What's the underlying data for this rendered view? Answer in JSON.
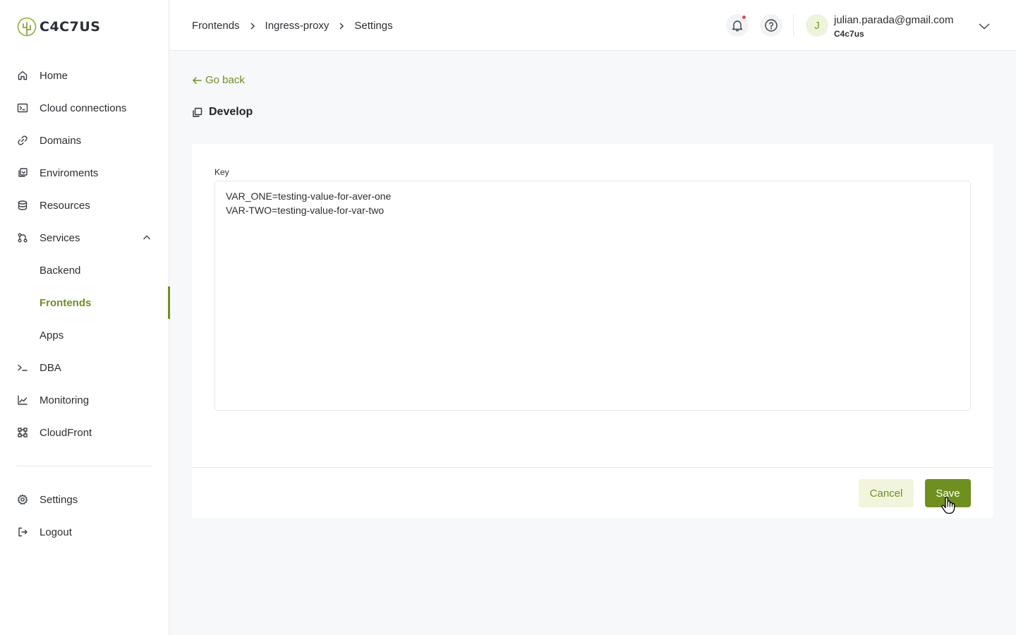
{
  "app": {
    "logo_text": "C4C7US"
  },
  "sidebar": {
    "items": [
      {
        "label": "Home",
        "icon": "home-icon"
      },
      {
        "label": "Cloud connections",
        "icon": "terminal-box-icon"
      },
      {
        "label": "Domains",
        "icon": "link-icon"
      },
      {
        "label": "Enviroments",
        "icon": "environments-icon"
      },
      {
        "label": "Resources",
        "icon": "database-icon"
      },
      {
        "label": "Services",
        "icon": "services-icon",
        "expanded": true
      },
      {
        "label": "Backend"
      },
      {
        "label": "Frontends",
        "active": true
      },
      {
        "label": "Apps"
      },
      {
        "label": "DBA",
        "icon": "terminal-prompt-icon"
      },
      {
        "label": "Monitoring",
        "icon": "line-chart-icon"
      },
      {
        "label": "CloudFront",
        "icon": "cloudfront-icon"
      }
    ],
    "bottom": [
      {
        "label": "Settings",
        "icon": "gear-icon"
      },
      {
        "label": "Logout",
        "icon": "logout-icon"
      }
    ]
  },
  "header": {
    "breadcrumb": [
      "Frontends",
      "Ingress-proxy",
      "Settings"
    ],
    "user": {
      "initial": "J",
      "email": "julian.parada@gmail.com",
      "org": "C4c7us"
    },
    "has_notification": true
  },
  "main": {
    "go_back": "Go back",
    "title": "Develop",
    "field_label": "Key",
    "textarea_lines": [
      "VAR_ONE=testing-value-for-aver-one",
      "VAR-TWO=testing-value-for-var-two"
    ],
    "cancel_label": "Cancel",
    "save_label": "Save"
  },
  "colors": {
    "accent": "#6f8f1f",
    "accent_light": "#f0f5dc",
    "notification": "#e5484d"
  }
}
